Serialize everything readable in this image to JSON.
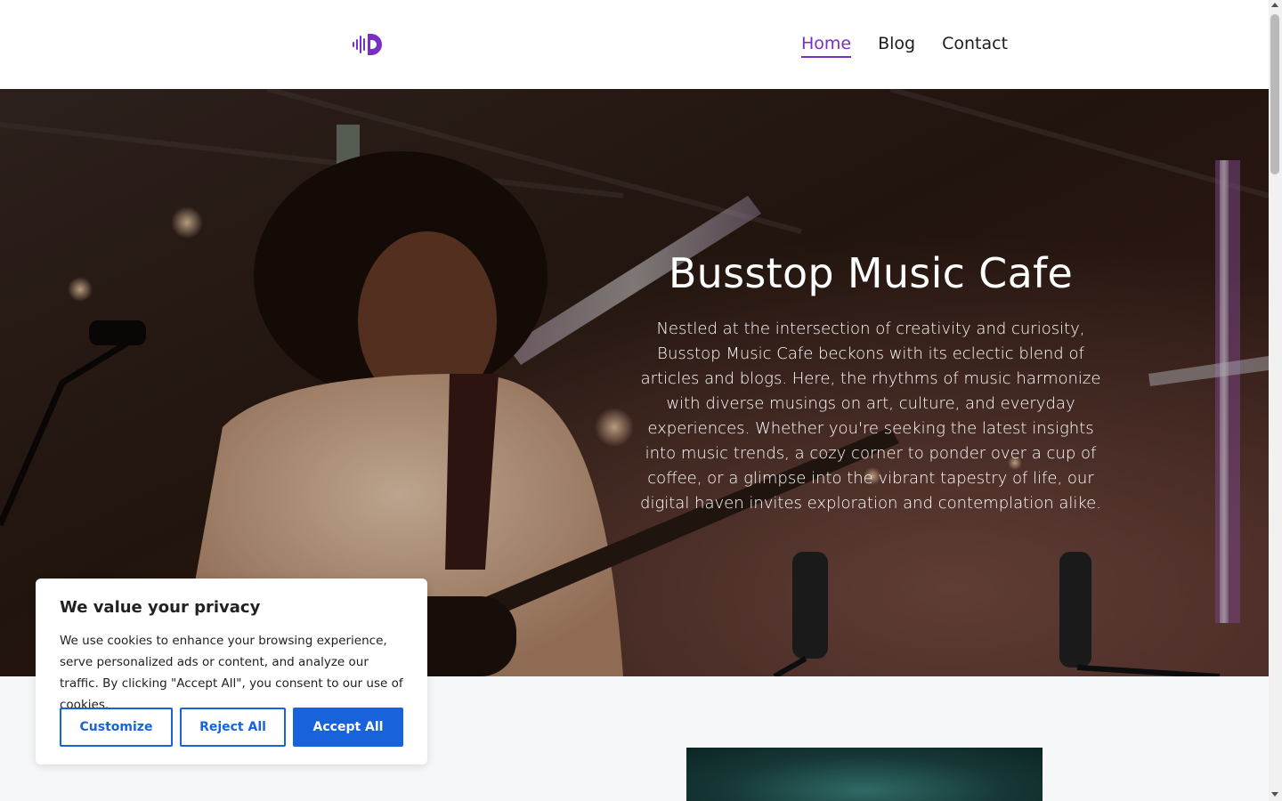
{
  "header": {
    "logo_icon": "sound-wave-logo-icon",
    "nav": [
      {
        "label": "Home",
        "active": true
      },
      {
        "label": "Blog",
        "active": false
      },
      {
        "label": "Contact",
        "active": false
      }
    ]
  },
  "hero": {
    "title": "Busstop Music Cafe",
    "description": "Nestled at the intersection of creativity and curiosity, Busstop Music Cafe beckons with its eclectic blend of articles and blogs. Here, the rhythms of music harmonize with diverse musings on art, culture, and everyday experiences. Whether you're seeking the latest insights into music trends, a cozy corner to ponder over a cup of coffee, or a glimpse into the vibrant tapestry of life, our digital haven invites exploration and contemplation alike."
  },
  "cookie_banner": {
    "title": "We value your privacy",
    "text": "We use cookies to enhance your browsing experience, serve personalized ads or content, and analyze our traffic. By clicking \"Accept All\", you consent to our use of cookies.",
    "customize_label": "Customize",
    "reject_label": "Reject All",
    "accept_label": "Accept All"
  },
  "colors": {
    "accent": "#7a2fc4",
    "button_blue": "#1863dc",
    "page_bg": "#f6f7f9"
  }
}
